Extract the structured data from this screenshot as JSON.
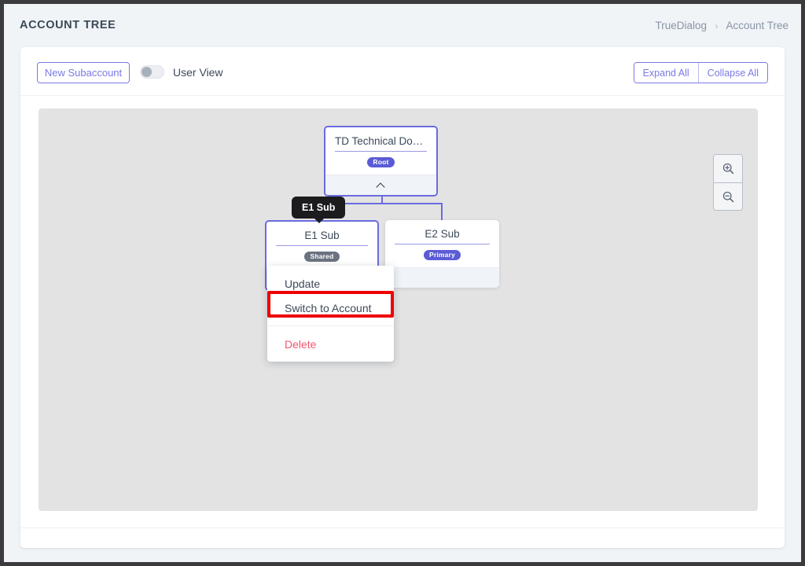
{
  "header": {
    "page_title": "ACCOUNT TREE",
    "breadcrumb": {
      "root": "TrueDialog",
      "separator": "›",
      "current": "Account Tree"
    }
  },
  "toolbar": {
    "new_subaccount_label": "New Subaccount",
    "user_view_label": "User View",
    "user_view_state": "off",
    "expand_all_label": "Expand All",
    "collapse_all_label": "Collapse All"
  },
  "canvas": {
    "zoom_in_icon": "magnifier-plus-icon",
    "zoom_out_icon": "magnifier-minus-icon"
  },
  "tree": {
    "root": {
      "title": "TD Technical Docu...",
      "badge": "Root",
      "badge_color": "#5b5bd6",
      "collapse_icon": "chevron-up-icon"
    },
    "children": [
      {
        "title": "E1 Sub",
        "badge": "Shared",
        "badge_color": "#6b7280",
        "selected": true
      },
      {
        "title": "E2 Sub",
        "badge": "Primary",
        "badge_color": "#5b5bd6",
        "selected": false
      }
    ],
    "edge_color": "#6b6be0"
  },
  "tooltip": {
    "text": "E1 Sub"
  },
  "context_menu": {
    "items": [
      {
        "label": "Update",
        "danger": false
      },
      {
        "label": "Switch to Account",
        "danger": false
      },
      {
        "label": "Delete",
        "danger": true
      }
    ],
    "highlighted_item": "Switch to Account",
    "highlight_color": "#ee0000"
  }
}
